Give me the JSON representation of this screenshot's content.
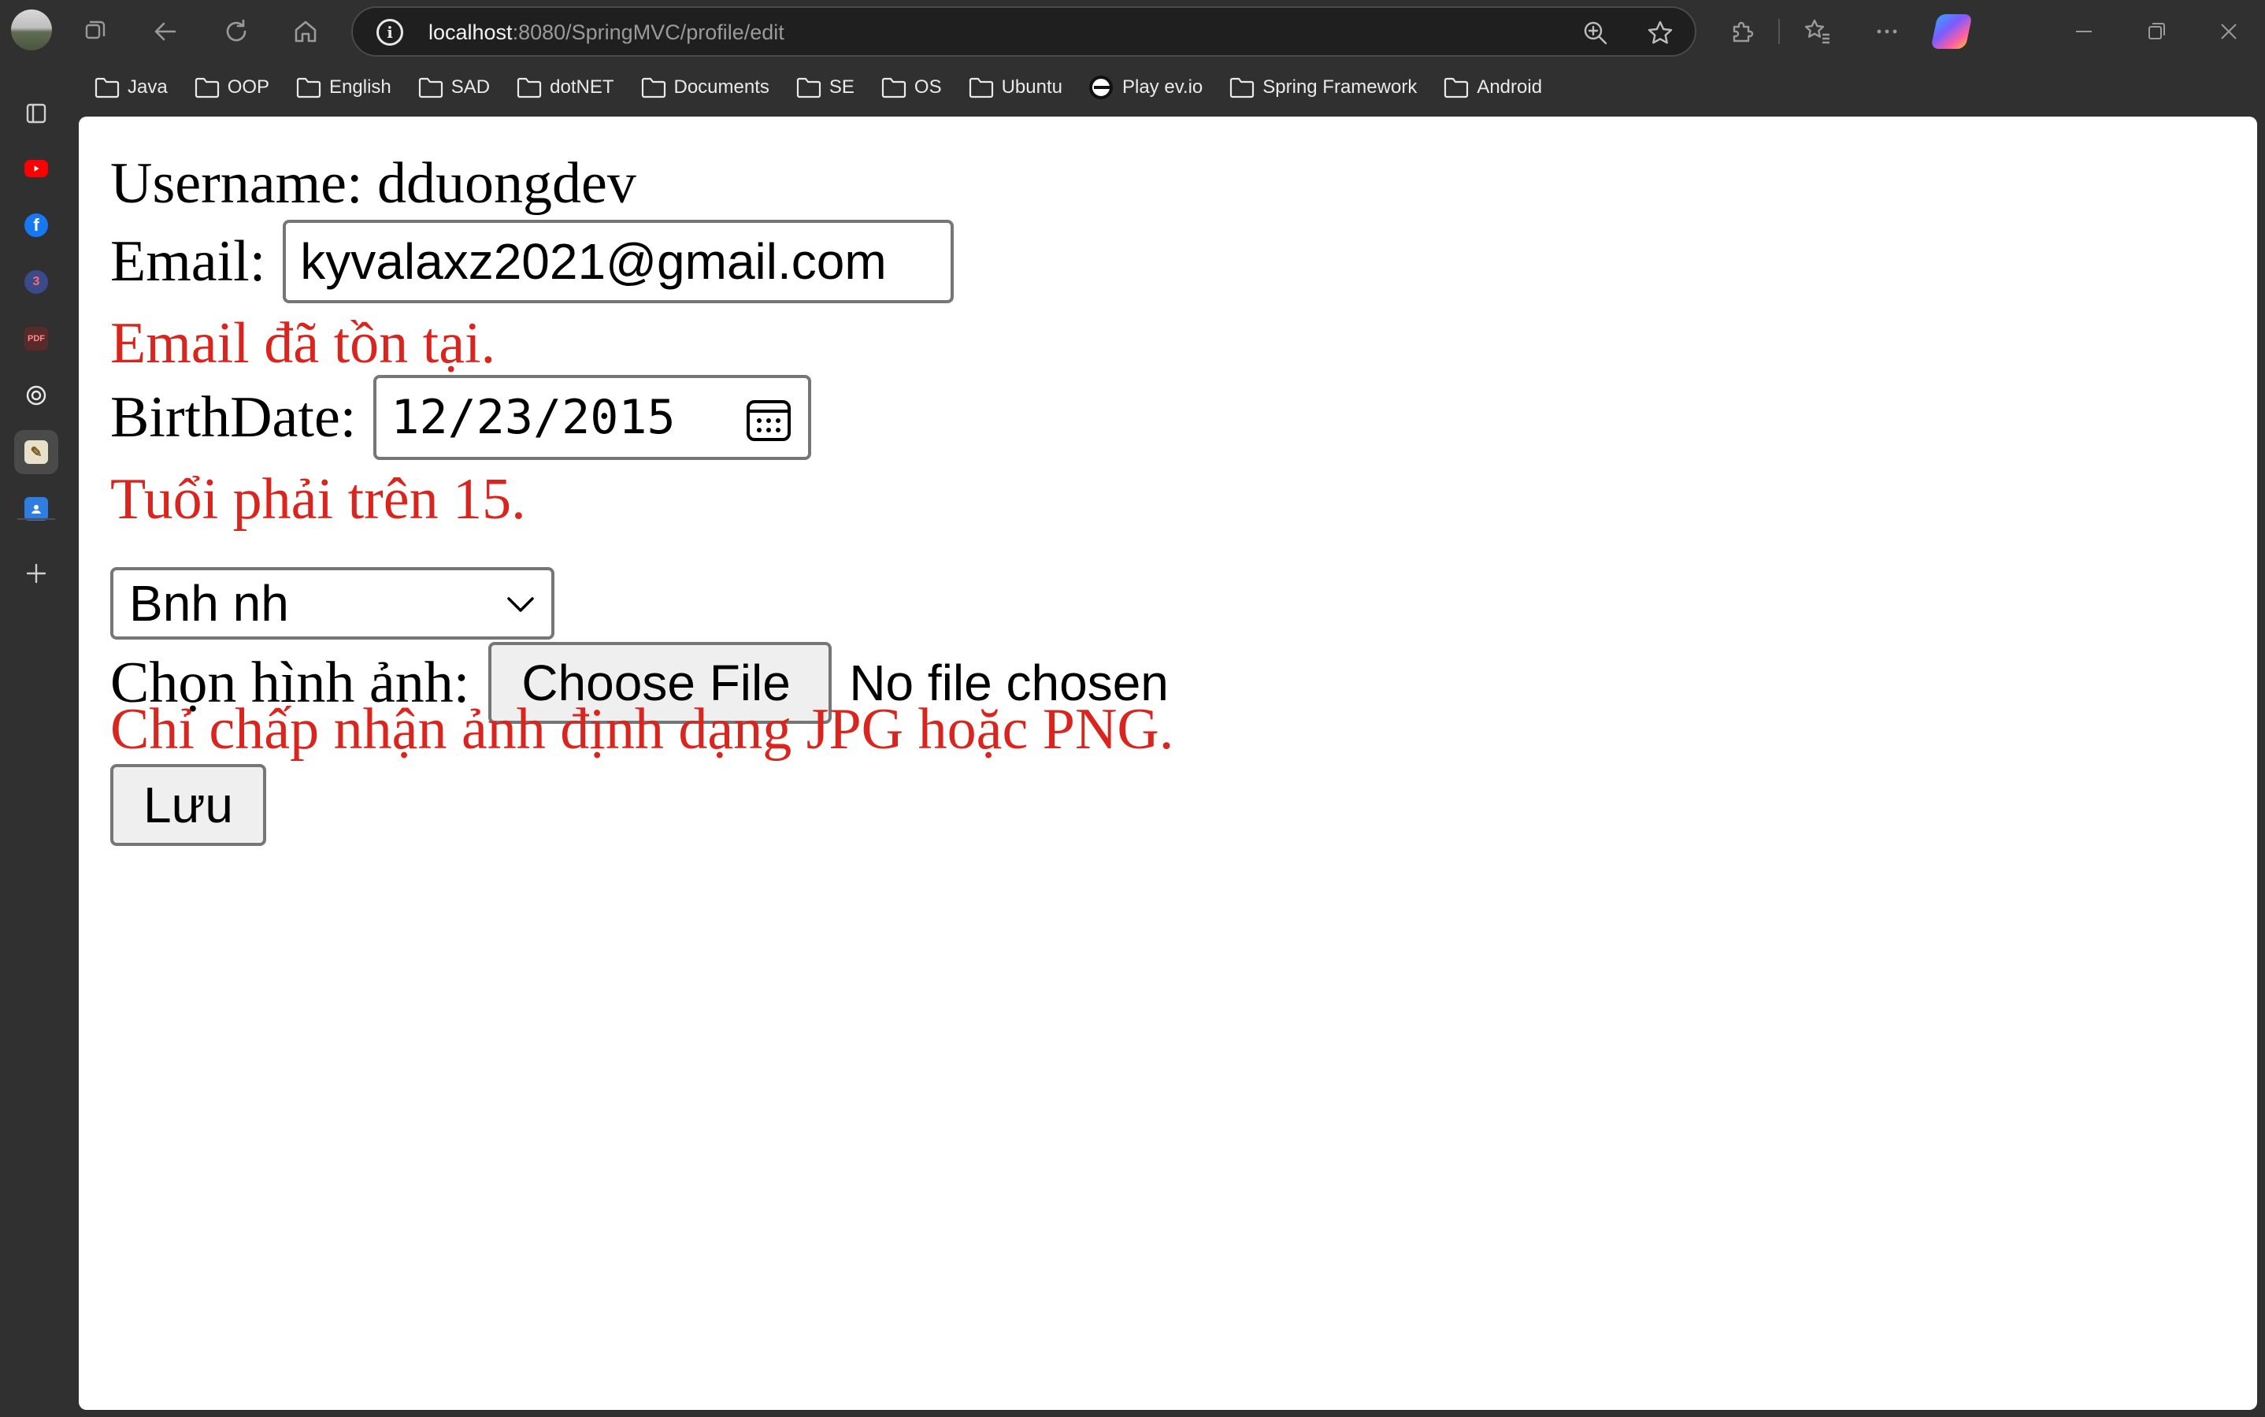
{
  "browser": {
    "url_host": "localhost",
    "url_path": ":8080/SpringMVC/profile/edit",
    "bookmarks": [
      "Java",
      "OOP",
      "English",
      "SAD",
      "dotNET",
      "Documents",
      "SE",
      "OS",
      "Ubuntu",
      "Play ev.io",
      "Spring Framework",
      "Android"
    ]
  },
  "form": {
    "username_label": "Username: dduongdev",
    "email_label": "Email:",
    "email_value": "kyvalaxz2021@gmail.com",
    "email_error": "Email đã tồn tại.",
    "birthdate_label": "BirthDate:",
    "birthdate_value": "12/23/2015",
    "birthdate_error": "Tuổi phải trên 15.",
    "select_value": "Bnh nh",
    "image_label": "Chọn hình ảnh:",
    "choose_file_label": "Choose File",
    "no_file_text": "No file chosen",
    "image_error": "Chỉ chấp nhận ảnh định dạng JPG hoặc PNG.",
    "save_label": "Lưu"
  },
  "colors": {
    "error": "#d9251d",
    "chrome_bg": "#303030"
  }
}
